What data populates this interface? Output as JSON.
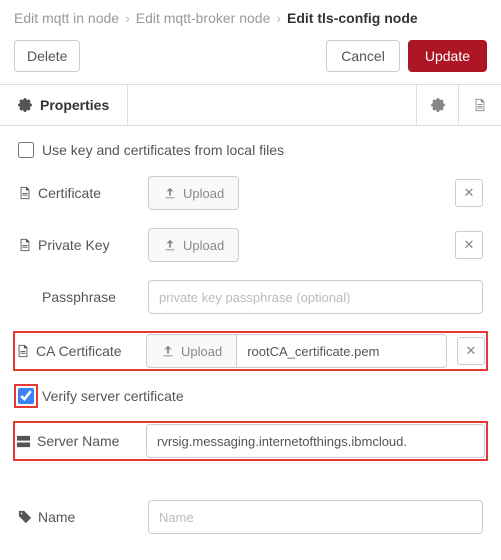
{
  "breadcrumb": {
    "lvl1": "Edit mqtt in node",
    "lvl2": "Edit mqtt-broker node",
    "lvl3": "Edit tls-config node"
  },
  "actions": {
    "delete": "Delete",
    "cancel": "Cancel",
    "update": "Update"
  },
  "tabs": {
    "properties": "Properties"
  },
  "form": {
    "useLocal_label": "Use key and certificates from local files",
    "certificate_label": "Certificate",
    "privateKey_label": "Private Key",
    "passphrase_label": "Passphrase",
    "passphrase_placeholder": "private key passphrase (optional)",
    "caCert_label": "CA Certificate",
    "caCert_filename": "rootCA_certificate.pem",
    "verify_label": "Verify server certificate",
    "serverName_label": "Server Name",
    "serverName_value": "rvrsig.messaging.internetofthings.ibmcloud.",
    "name_label": "Name",
    "name_placeholder": "Name",
    "upload_label": "Upload"
  }
}
